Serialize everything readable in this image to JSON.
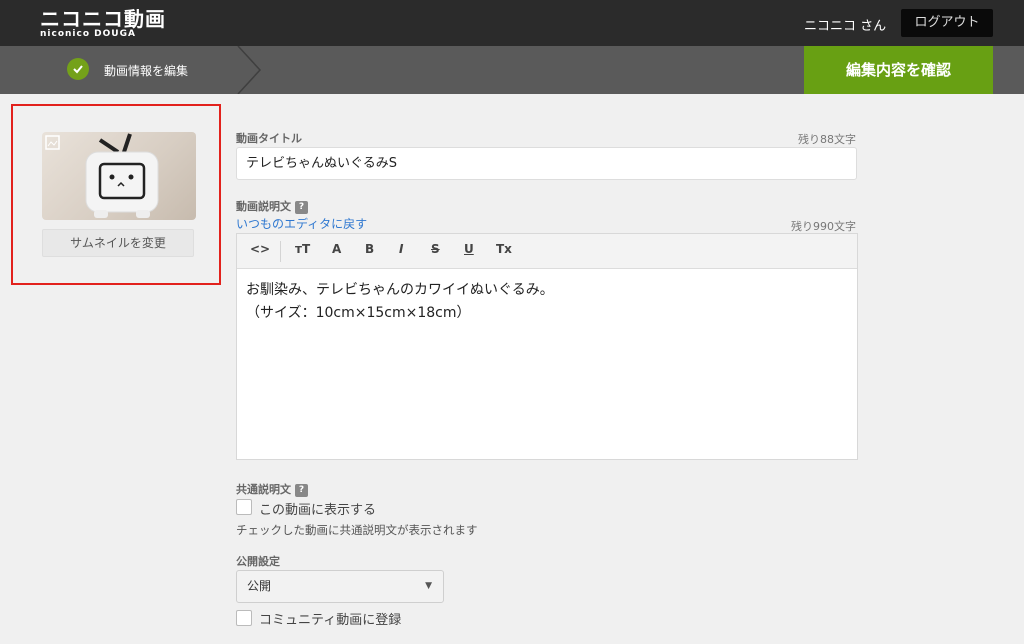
{
  "header": {
    "logo_text": "ニコニコ動画",
    "logo_subtext": "niconico DOUGA",
    "username": "ニコニコ さん",
    "logout_label": "ログアウト"
  },
  "steps": {
    "current_label": "動画情報を編集",
    "confirm_label": "編集内容を確認"
  },
  "thumbnail": {
    "change_label": "サムネイルを変更"
  },
  "form": {
    "title_label": "動画タイトル",
    "title_remaining": "残り88文字",
    "title_value": "テレビちゃんぬいぐるみS",
    "description_label": "動画説明文",
    "description_help": "?",
    "editor_link": "いつものエディタに戻す",
    "description_remaining": "残り990文字",
    "toolbar": {
      "source": "<>",
      "font_size": "тT",
      "font_color": "A",
      "bold": "B",
      "italic": "I",
      "strike": "S",
      "underline": "U",
      "clear": "Tx"
    },
    "description_lines": [
      "お馴染み、テレビちゃんのカワイイぬいぐるみ。",
      "（サイズ：10cm×15cm×18cm）"
    ],
    "common_desc_label": "共通説明文",
    "common_desc_help": "?",
    "common_desc_checkbox": "この動画に表示する",
    "common_desc_hint": "チェックした動画に共通説明文が表示されます",
    "visibility_label": "公開設定",
    "visibility_value": "公開",
    "community_checkbox": "コミュニティ動画に登録"
  },
  "colors": {
    "accent_green": "#68a013",
    "highlight_red": "#e2211c",
    "link_blue": "#2f78d0"
  }
}
